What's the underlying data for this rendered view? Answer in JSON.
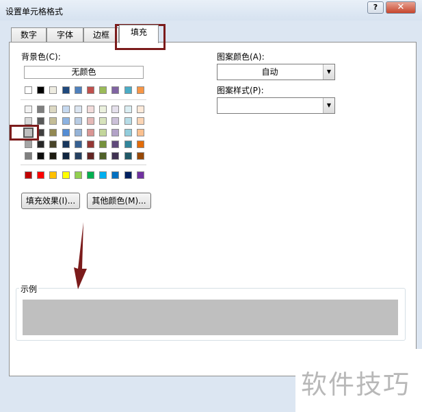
{
  "window": {
    "title": "设置单元格格式",
    "help": "?",
    "close": "✕"
  },
  "tabs": [
    "数字",
    "字体",
    "边框",
    "填充"
  ],
  "fill": {
    "background_label": "背景色(C):",
    "no_color": "无颜色",
    "fill_effects": "填充效果(I)...",
    "more_colors": "其他颜色(M)...",
    "pattern_color_label": "图案颜色(A):",
    "pattern_color_value": "自动",
    "pattern_style_label": "图案样式(P):",
    "pattern_style_value": "",
    "sample_label": "示例",
    "sample_color": "#bfbfbf"
  },
  "palette": {
    "theme_top": [
      "#ffffff",
      "#000000",
      "#eeece1",
      "#1f497d",
      "#4f81bd",
      "#c0504d",
      "#9bbb59",
      "#8064a2",
      "#4bacc6",
      "#f79646"
    ],
    "tints": [
      [
        "#f2f2f2",
        "#7f7f7f",
        "#ddd9c3",
        "#c6d9f0",
        "#dbe5f1",
        "#f2dcdb",
        "#ebf1dd",
        "#e5e0ec",
        "#dbeef3",
        "#fdeada"
      ],
      [
        "#d8d8d8",
        "#595959",
        "#c4bd97",
        "#8db3e2",
        "#b8cce4",
        "#e5b9b7",
        "#d7e3bc",
        "#ccc1d9",
        "#b7dde8",
        "#fbd5b5"
      ],
      [
        "#bfbfbf",
        "#3f3f3f",
        "#938953",
        "#548dd4",
        "#95b3d7",
        "#d99694",
        "#c3d69b",
        "#b2a2c7",
        "#92cddc",
        "#fac08f"
      ],
      [
        "#a5a5a5",
        "#262626",
        "#494429",
        "#17365d",
        "#366092",
        "#953734",
        "#76923c",
        "#5f497a",
        "#31859b",
        "#e36c09"
      ],
      [
        "#7f7f7f",
        "#0c0c0c",
        "#1d1b10",
        "#0f243e",
        "#244061",
        "#632423",
        "#4f6128",
        "#3f3151",
        "#205867",
        "#974806"
      ]
    ],
    "standard": [
      "#c00000",
      "#ff0000",
      "#ffc000",
      "#ffff00",
      "#92d050",
      "#00b050",
      "#00b0f0",
      "#0070c0",
      "#002060",
      "#7030a0"
    ]
  },
  "watermark": "软件技巧"
}
